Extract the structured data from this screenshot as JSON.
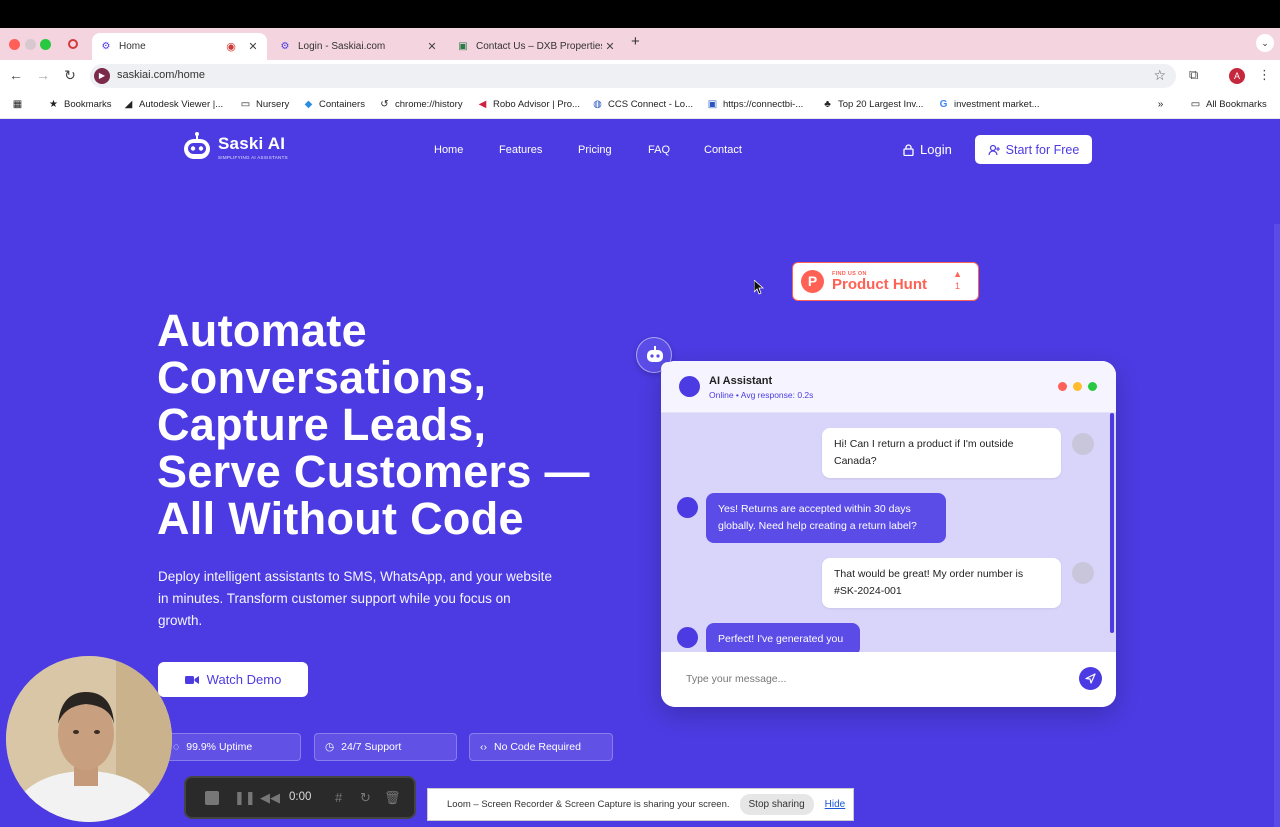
{
  "browser": {
    "tabs": [
      {
        "title": "Home",
        "active": true
      },
      {
        "title": "Login - Saskiai.com",
        "active": false
      },
      {
        "title": "Contact Us – DXB Properties",
        "active": false
      }
    ],
    "url": "saskiai.com/home",
    "avatar_letter": "A",
    "bookmarks": [
      "Bookmarks",
      "Autodesk Viewer |...",
      "Nursery",
      "Containers",
      "chrome://history",
      "Robo Advisor | Pro...",
      "CCS Connect - Lo...",
      "https://connectbi-...",
      "Top 20 Largest Inv...",
      "investment market..."
    ],
    "all_bookmarks": "All Bookmarks"
  },
  "site": {
    "logo_name": "Saski AI",
    "logo_tagline": "SIMPLIFYING AI ASSISTANTS",
    "nav": [
      "Home",
      "Features",
      "Pricing",
      "FAQ",
      "Contact"
    ],
    "login": "Login",
    "cta": "Start for Free",
    "product_hunt": {
      "small": "FIND US ON",
      "big": "Product Hunt",
      "votes": "1"
    },
    "hero_lines": [
      "Automate",
      "Conversations,",
      "Capture Leads,",
      "Serve Customers —",
      "All Without Code"
    ],
    "hero_sub": "Deploy intelligent assistants to SMS, WhatsApp, and your website in minutes. Transform customer support while you focus on growth.",
    "watch_demo": "Watch Demo",
    "chips": [
      "99.9% Uptime",
      "24/7 Support",
      "No Code Required"
    ]
  },
  "chat": {
    "name": "AI Assistant",
    "status": "Online • Avg response: 0.2s",
    "messages": [
      {
        "from": "user",
        "text": "Hi! Can I return a product if I'm outside Canada?"
      },
      {
        "from": "bot",
        "text": "Yes! Returns are accepted within 30 days globally. Need help creating a return label?"
      },
      {
        "from": "user",
        "text": "That would be great! My order number is #SK-2024-001"
      },
      {
        "from": "bot",
        "text": "Perfect! I've generated you"
      }
    ],
    "input_placeholder": "Type your message..."
  },
  "recorder": {
    "time": "0:00",
    "share_message": "Loom – Screen Recorder & Screen Capture is sharing your screen.",
    "stop_sharing": "Stop sharing",
    "hide": "Hide"
  },
  "colors": {
    "brand": "#4c3be2",
    "product_hunt": "#ff6154"
  }
}
